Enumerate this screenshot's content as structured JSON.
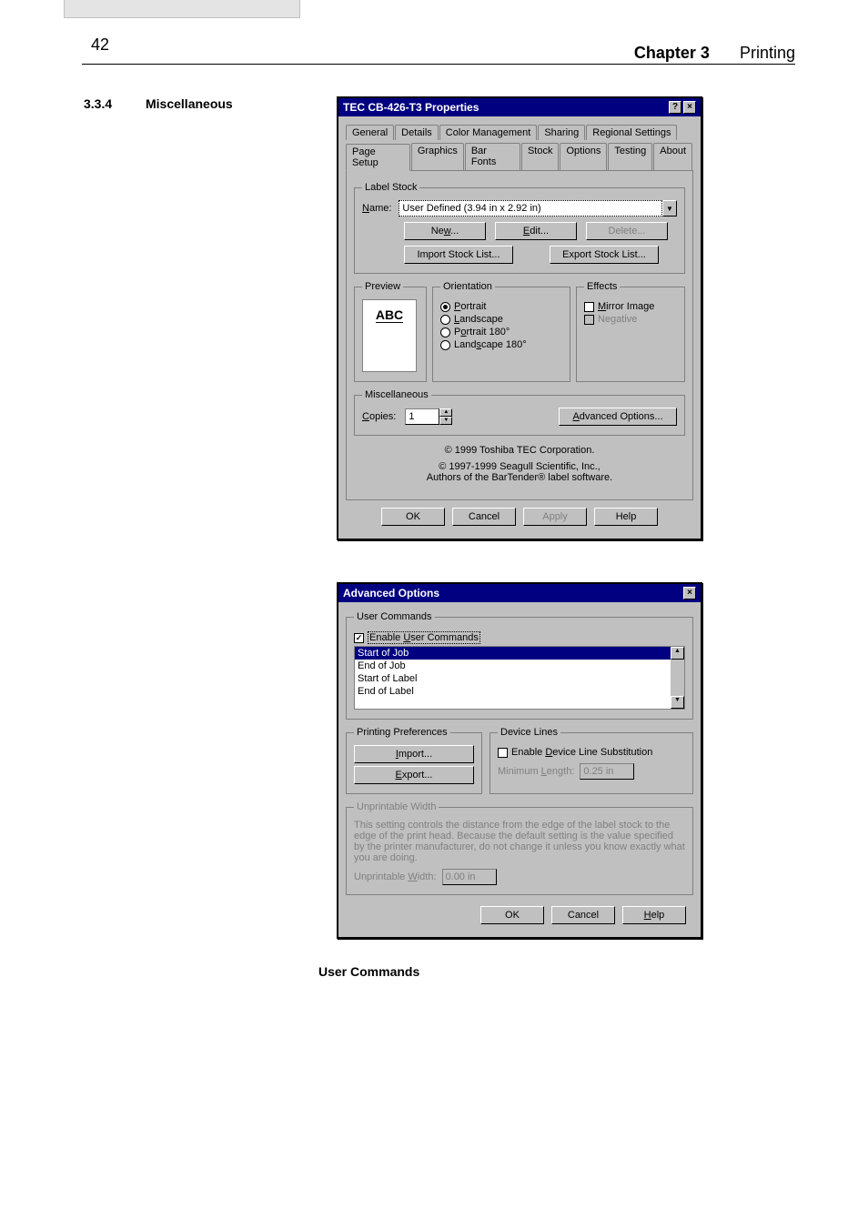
{
  "header": {
    "chapter": "Chapter 3",
    "title": "Printing"
  },
  "section": {
    "num": "3.3.4",
    "title": "Miscellaneous"
  },
  "page_number": "42",
  "dlg1": {
    "title": "TEC CB-426-T3 Properties",
    "help_btn": "?",
    "close_btn": "×",
    "tabs_row1": [
      "General",
      "Details",
      "Color Management",
      "Sharing",
      "Regional Settings"
    ],
    "tabs_row2": [
      "Page Setup",
      "Graphics",
      "Bar Fonts",
      "Stock",
      "Options",
      "Testing",
      "About"
    ],
    "active_tab": "Page Setup",
    "label_stock": {
      "legend": "Label Stock",
      "name_lbl": "Name:",
      "name_value": "User Defined (3.94 in x 2.92 in)",
      "new_btn": "New...",
      "edit_btn": "Edit...",
      "delete_btn": "Delete...",
      "import_btn": "Import Stock List...",
      "export_btn": "Export Stock List..."
    },
    "preview": {
      "legend": "Preview",
      "sample": "ABC"
    },
    "orientation": {
      "legend": "Orientation",
      "portrait": "Portrait",
      "landscape": "Landscape",
      "portrait180": "Portrait 180°",
      "landscape180": "Landscape 180°"
    },
    "effects": {
      "legend": "Effects",
      "mirror": "Mirror Image",
      "negative": "Negative"
    },
    "misc": {
      "legend": "Miscellaneous",
      "copies_lbl": "Copies:",
      "copies_val": "1",
      "advanced_btn": "Advanced Options..."
    },
    "copyright1": "© 1999 Toshiba TEC Corporation.",
    "copyright2": "© 1997-1999 Seagull Scientific, Inc.,",
    "copyright3": "Authors of the BarTender® label software.",
    "buttons": {
      "ok": "OK",
      "cancel": "Cancel",
      "apply": "Apply",
      "help": "Help"
    }
  },
  "dlg2": {
    "title": "Advanced Options",
    "close_btn": "×",
    "user_commands": {
      "legend": "User Commands",
      "enable_lbl": "Enable User Commands",
      "items": [
        "Start of Job",
        "End of Job",
        "Start of Label",
        "End of Label"
      ]
    },
    "printing_prefs": {
      "legend": "Printing Preferences",
      "import_btn": "Import...",
      "export_btn": "Export..."
    },
    "device_lines": {
      "legend": "Device Lines",
      "enable_lbl": "Enable Device Line Substitution",
      "min_len_lbl": "Minimum Length:",
      "min_len_val": "0.25 in"
    },
    "unprintable": {
      "legend": "Unprintable Width",
      "desc": "This setting controls the distance from the edge of the label stock to the edge of the print head. Because the default setting is the value specified by the printer manufacturer, do not change it unless you know exactly what you are doing.",
      "width_lbl": "Unprintable Width:",
      "width_val": "0.00 in"
    },
    "buttons": {
      "ok": "OK",
      "cancel": "Cancel",
      "help": "Help"
    }
  },
  "subheading": "User Commands"
}
